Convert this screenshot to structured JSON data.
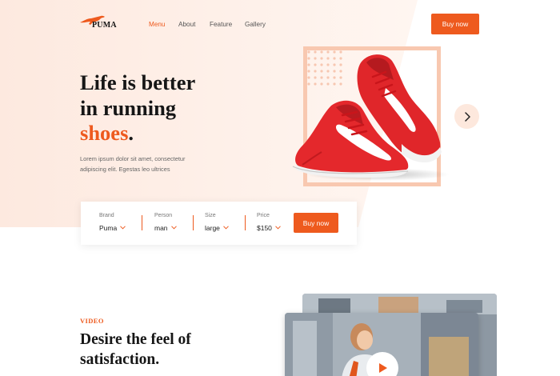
{
  "header": {
    "brand": "PUMA",
    "logo_icon": "leaping-cat-icon",
    "nav": [
      {
        "label": "Menu",
        "active": true
      },
      {
        "label": "About",
        "active": false
      },
      {
        "label": "Feature",
        "active": false
      },
      {
        "label": "Gallery",
        "active": false
      }
    ],
    "cta_label": "Buy now"
  },
  "hero": {
    "headline_line1": "Life is better",
    "headline_line2": "in running",
    "headline_accent": "shoes",
    "headline_period": ".",
    "description": "Lorem ipsum dolor sit amet, consectetur adipiscing elit. Egestas leo ultrices",
    "next_icon": "chevron-right-icon"
  },
  "filters": {
    "items": [
      {
        "label": "Brand",
        "value": "Puma"
      },
      {
        "label": "Person",
        "value": "man"
      },
      {
        "label": "Size",
        "value": "large"
      },
      {
        "label": "Price",
        "value": "$150"
      }
    ],
    "chevron_icon": "chevron-down-icon",
    "buy_label": "Buy now"
  },
  "video": {
    "kicker": "VIDEO",
    "title_line1": "Desire the feel of",
    "title_line2": "satisfaction.",
    "play_icon": "play-icon"
  },
  "colors": {
    "accent": "#ee5a1e",
    "hero_bg": "#fdeee6",
    "frame": "#f8c8b0",
    "text_dark": "#161616"
  }
}
